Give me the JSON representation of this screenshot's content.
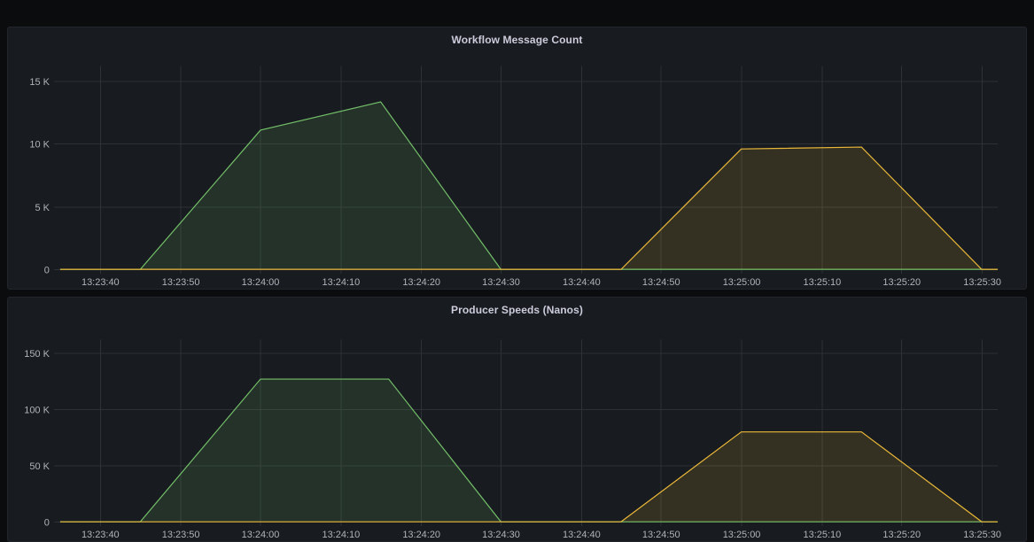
{
  "theme": {
    "page_background": "#0b0c0e",
    "panel_background": "#181b1f",
    "grid_color": "#2c3235",
    "text_color": "#ccccdc",
    "axis_text_color": "#b0b4ba",
    "green": "#73bf69",
    "yellow": "#eab839"
  },
  "panels": [
    {
      "id": "workflow-message-count",
      "title": "Workflow Message Count"
    },
    {
      "id": "producer-speeds-nanos",
      "title": "Producer Speeds (Nanos)"
    }
  ],
  "chart_data": [
    {
      "type": "area",
      "title": "Workflow Message Count",
      "xlabel": "",
      "ylabel": "",
      "grid": true,
      "legend": "none",
      "x_tick_labels": [
        "13:23:40",
        "13:23:50",
        "13:24:00",
        "13:24:10",
        "13:24:20",
        "13:24:30",
        "13:24:40",
        "13:24:50",
        "13:25:00",
        "13:25:10",
        "13:25:20",
        "13:25:30"
      ],
      "x_tick_seconds": [
        220,
        230,
        240,
        250,
        260,
        270,
        280,
        290,
        300,
        310,
        320,
        330
      ],
      "xlim_seconds": [
        215,
        332
      ],
      "y_tick_labels": [
        "0",
        "5 K",
        "10 K",
        "15 K"
      ],
      "y_tick_values": [
        0,
        5000,
        10000,
        15000
      ],
      "ylim": [
        0,
        16200
      ],
      "series": [
        {
          "name": "green-series",
          "color": "#73bf69",
          "points": [
            {
              "t": 215,
              "v": 0
            },
            {
              "t": 225,
              "v": 0
            },
            {
              "t": 240,
              "v": 11100
            },
            {
              "t": 255,
              "v": 13350
            },
            {
              "t": 270,
              "v": 0
            },
            {
              "t": 332,
              "v": 0
            }
          ]
        },
        {
          "name": "yellow-series",
          "color": "#eab839",
          "points": [
            {
              "t": 215,
              "v": 0
            },
            {
              "t": 285,
              "v": 0
            },
            {
              "t": 300,
              "v": 9600
            },
            {
              "t": 315,
              "v": 9750
            },
            {
              "t": 330,
              "v": 0
            },
            {
              "t": 332,
              "v": 0
            }
          ]
        }
      ]
    },
    {
      "type": "area",
      "title": "Producer Speeds (Nanos)",
      "xlabel": "",
      "ylabel": "",
      "grid": true,
      "legend": "none",
      "x_tick_labels": [
        "13:23:40",
        "13:23:50",
        "13:24:00",
        "13:24:10",
        "13:24:20",
        "13:24:30",
        "13:24:40",
        "13:24:50",
        "13:25:00",
        "13:25:10",
        "13:25:20",
        "13:25:30"
      ],
      "x_tick_seconds": [
        220,
        230,
        240,
        250,
        260,
        270,
        280,
        290,
        300,
        310,
        320,
        330
      ],
      "xlim_seconds": [
        215,
        332
      ],
      "y_tick_labels": [
        "0",
        "50 K",
        "100 K",
        "150 K"
      ],
      "y_tick_values": [
        0,
        50000,
        100000,
        150000
      ],
      "ylim": [
        0,
        162000
      ],
      "series": [
        {
          "name": "green-series",
          "color": "#73bf69",
          "points": [
            {
              "t": 215,
              "v": 0
            },
            {
              "t": 225,
              "v": 0
            },
            {
              "t": 240,
              "v": 127000
            },
            {
              "t": 256,
              "v": 127000
            },
            {
              "t": 270,
              "v": 0
            },
            {
              "t": 332,
              "v": 0
            }
          ]
        },
        {
          "name": "yellow-series",
          "color": "#eab839",
          "points": [
            {
              "t": 215,
              "v": 0
            },
            {
              "t": 285,
              "v": 0
            },
            {
              "t": 300,
              "v": 80000
            },
            {
              "t": 315,
              "v": 80000
            },
            {
              "t": 330,
              "v": 0
            },
            {
              "t": 332,
              "v": 0
            }
          ]
        }
      ]
    }
  ]
}
